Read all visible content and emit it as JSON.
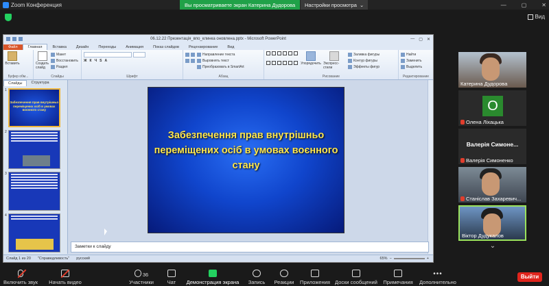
{
  "zoom": {
    "window_title": "Zoom Конференция",
    "share_banner": "Вы просматриваете экран Катерина Дудорова",
    "view_options": "Настройки просмотра",
    "view_button": "Вид",
    "accent_green": "#23d160"
  },
  "ppt": {
    "title": "06.12.22 Презентація_впо_клинка оновлена.pptx - Microsoft PowerPoint",
    "tabs": [
      "Файл",
      "Главная",
      "Вставка",
      "Дизайн",
      "Переходы",
      "Анимация",
      "Показ слайдов",
      "Рецензирование",
      "Вид"
    ],
    "ribbon": {
      "paste_label": "Вставить",
      "create_slide_label": "Создать слайд",
      "layout_label": "Макет",
      "restore_label": "Восстановить",
      "section_label": "Раздел",
      "clipboard_group": "Буфер обм...",
      "slides_group": "Слайды",
      "font_group": "Шрифт",
      "paragraph_group": "Абзац",
      "text_direction": "Направление текста",
      "align_text": "Выровнять текст",
      "convert_smartart": "Преобразовать в SmartArt",
      "arrange_label": "Упорядочить",
      "quick_styles_label": "Экспресс-стили",
      "shape_fill": "Заливка фигуры",
      "shape_outline": "Контур фигуры",
      "shape_effects": "Эффекты фигур",
      "drawing_group": "Рисование",
      "find_label": "Найти",
      "replace_label": "Заменить",
      "select_label": "Выделить",
      "editing_group": "Редактирование"
    },
    "pane_tabs": [
      "Слайды",
      "Структура"
    ],
    "thumbnails": [
      {
        "num": "1",
        "text": "Забезпечення прав внутрішньо переміщених осіб в умовах воєнного стану"
      },
      {
        "num": "2",
        "text": ""
      },
      {
        "num": "3",
        "text": ""
      },
      {
        "num": "4",
        "text": ""
      }
    ],
    "slide_title": "Забезпечення прав внутрішньо переміщених осіб в умовах воєнного стану",
    "notes_placeholder": "Заметки к слайду",
    "status": {
      "slide_count": "Слайд 1 из 20",
      "theme": "\"Справедливость\"",
      "language": "русский",
      "zoom": "65%"
    }
  },
  "participants": [
    {
      "name": "Катерина Дудорова",
      "type": "photo"
    },
    {
      "name": "Олена Ліхацька",
      "type": "avatar",
      "initial": "О"
    },
    {
      "name": "Валерія Симоненко",
      "type": "name",
      "display": "Валерія Симоне..."
    },
    {
      "name": "Станіслав Захаревич...",
      "type": "photo"
    },
    {
      "name": "Віктор Дудукалов",
      "type": "photo"
    }
  ],
  "toolbar": {
    "unmute": "Включить звук",
    "start_video": "Начать видео",
    "participants": "Участники",
    "participants_count": "36",
    "chat": "Чат",
    "share_screen": "Демонстрация экрана",
    "record": "Запись",
    "reactions": "Реакции",
    "apps": "Приложения",
    "whiteboards": "Доски сообщений",
    "notes": "Примечания",
    "more": "Дополнительно",
    "leave": "Выйти"
  }
}
